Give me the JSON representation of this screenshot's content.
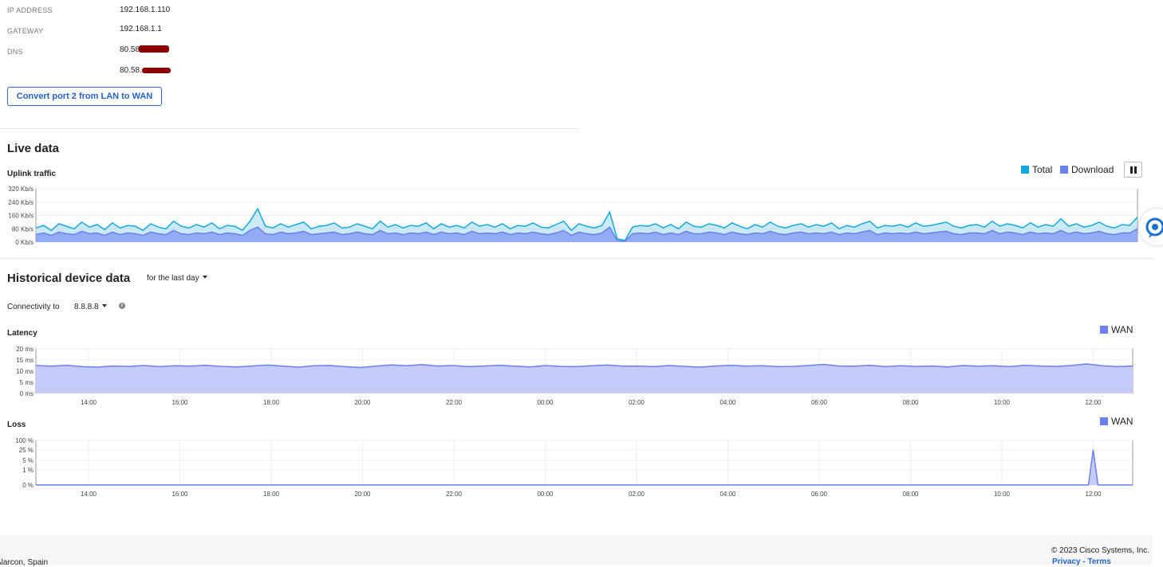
{
  "network": {
    "ip_label": "IP ADDRESS",
    "ip_value": "192.168.1.110",
    "gateway_label": "GATEWAY",
    "gateway_value": "192.168.1.1",
    "dns_label": "DNS",
    "dns_value_1": "80.58.",
    "dns_value_2": "80.58."
  },
  "convert_button": "Convert port 2 from LAN to WAN",
  "live": {
    "title": "Live data",
    "uplink_title": "Uplink traffic",
    "legend_total": "Total",
    "legend_download": "Download",
    "colors": {
      "total": "#13a8e0",
      "download": "#6b7fef"
    }
  },
  "historical": {
    "title": "Historical device data",
    "range_select": "for the last day",
    "connectivity_label": "Connectivity to",
    "connectivity_target": "8.8.8.8",
    "latency_title": "Latency",
    "loss_title": "Loss",
    "wan_legend": "WAN",
    "color": "#6b7fef"
  },
  "footer": {
    "location": "Alarcon, Spain",
    "copyright": "© 2023 Cisco Systems, Inc.",
    "privacy": "Privacy",
    "terms": "Terms"
  },
  "chart_data": [
    {
      "type": "area",
      "title": "Uplink traffic",
      "ylim": [
        0,
        320
      ],
      "y_ticks": [
        "320 Kb/s",
        "240 Kb/s",
        "160 Kb/s",
        "80 Kb/s",
        "0 Kb/s"
      ],
      "series": [
        {
          "name": "Total",
          "values": [
            85,
            100,
            70,
            110,
            95,
            80,
            120,
            90,
            105,
            75,
            115,
            85,
            100,
            95,
            70,
            110,
            90,
            80,
            125,
            95,
            85,
            105,
            90,
            115,
            80,
            100,
            95,
            70,
            125,
            200,
            95,
            85,
            110,
            90,
            105,
            120,
            80,
            95,
            100,
            115,
            85,
            90,
            110,
            95,
            80,
            125,
            90,
            105,
            85,
            100,
            95,
            115,
            80,
            110,
            90,
            100,
            85,
            120,
            95,
            105,
            90,
            110,
            80,
            100,
            95,
            115,
            90,
            85,
            105,
            125,
            70,
            110,
            95,
            85,
            100,
            180,
            20,
            10,
            90,
            100,
            95,
            110,
            85,
            105,
            80,
            120,
            95,
            90,
            110,
            100,
            85,
            115,
            95,
            80,
            105,
            90,
            120,
            95,
            85,
            100,
            110,
            90,
            105,
            95,
            115,
            80,
            100,
            90,
            110,
            125,
            85,
            100,
            95,
            105,
            90,
            115,
            95,
            100,
            110,
            120,
            95,
            85,
            100,
            105,
            90,
            125,
            95,
            110,
            100,
            85,
            115,
            90,
            105,
            95,
            140,
            95,
            110,
            90,
            100,
            120,
            95,
            85,
            105,
            100,
            150
          ]
        },
        {
          "name": "Download",
          "values": [
            45,
            55,
            40,
            60,
            50,
            45,
            65,
            50,
            55,
            40,
            60,
            45,
            55,
            50,
            40,
            60,
            50,
            45,
            70,
            50,
            45,
            55,
            50,
            60,
            45,
            55,
            50,
            40,
            70,
            90,
            50,
            45,
            60,
            50,
            55,
            65,
            45,
            50,
            55,
            60,
            45,
            50,
            60,
            50,
            45,
            70,
            50,
            55,
            45,
            55,
            50,
            60,
            45,
            60,
            50,
            55,
            45,
            65,
            50,
            55,
            50,
            60,
            45,
            55,
            50,
            60,
            50,
            45,
            55,
            70,
            40,
            60,
            50,
            45,
            55,
            90,
            10,
            5,
            50,
            55,
            50,
            60,
            45,
            55,
            45,
            65,
            50,
            50,
            60,
            55,
            45,
            60,
            50,
            45,
            55,
            50,
            65,
            50,
            45,
            55,
            60,
            50,
            55,
            50,
            60,
            45,
            55,
            50,
            60,
            70,
            45,
            55,
            50,
            55,
            50,
            60,
            50,
            55,
            60,
            65,
            50,
            45,
            55,
            55,
            50,
            70,
            50,
            60,
            55,
            45,
            60,
            50,
            55,
            50,
            70,
            50,
            60,
            50,
            55,
            65,
            50,
            45,
            55,
            55,
            80
          ]
        }
      ]
    },
    {
      "type": "line",
      "title": "Latency",
      "x_ticks": [
        "14:00",
        "16:00",
        "18:00",
        "20:00",
        "22:00",
        "00:00",
        "02:00",
        "04:00",
        "06:00",
        "08:00",
        "10:00",
        "12:00"
      ],
      "y_ticks": [
        "20 ms",
        "15 ms",
        "10 ms",
        "5 ms",
        "0 ms"
      ],
      "ylim": [
        0,
        20
      ],
      "series": [
        {
          "name": "WAN",
          "values": [
            12.5,
            12.2,
            12.6,
            12.0,
            11.8,
            12.3,
            12.1,
            12.5,
            12.0,
            12.4,
            12.2,
            12.6,
            12.1,
            11.9,
            12.3,
            12.7,
            12.2,
            11.8,
            12.4,
            12.5,
            12.0,
            11.6,
            12.2,
            12.8,
            12.4,
            12.9,
            12.3,
            12.5,
            12.0,
            12.3,
            12.6,
            12.2,
            11.9,
            12.5,
            12.1,
            12.0,
            12.4,
            12.7,
            12.2,
            12.3,
            12.0,
            12.5,
            12.1,
            11.8,
            12.3,
            12.6,
            12.2,
            12.4,
            12.0,
            12.1,
            12.5,
            13.0,
            12.3,
            12.2,
            12.6,
            12.0,
            12.4,
            12.1,
            12.3,
            11.9,
            12.5,
            12.2,
            12.4,
            12.0,
            12.6,
            12.3,
            12.1,
            12.5,
            13.2,
            12.4,
            12.0,
            12.3
          ]
        }
      ]
    },
    {
      "type": "area",
      "title": "Loss",
      "x_ticks": [
        "14:00",
        "16:00",
        "18:00",
        "20:00",
        "22:00",
        "00:00",
        "02:00",
        "04:00",
        "06:00",
        "08:00",
        "10:00",
        "12:00"
      ],
      "y_ticks": [
        "100 %",
        "25 %",
        "5 %",
        "1 %",
        "0 %"
      ],
      "series": [
        {
          "name": "WAN",
          "peak_x": "12:00",
          "peak_value_pct": 25
        }
      ]
    }
  ]
}
